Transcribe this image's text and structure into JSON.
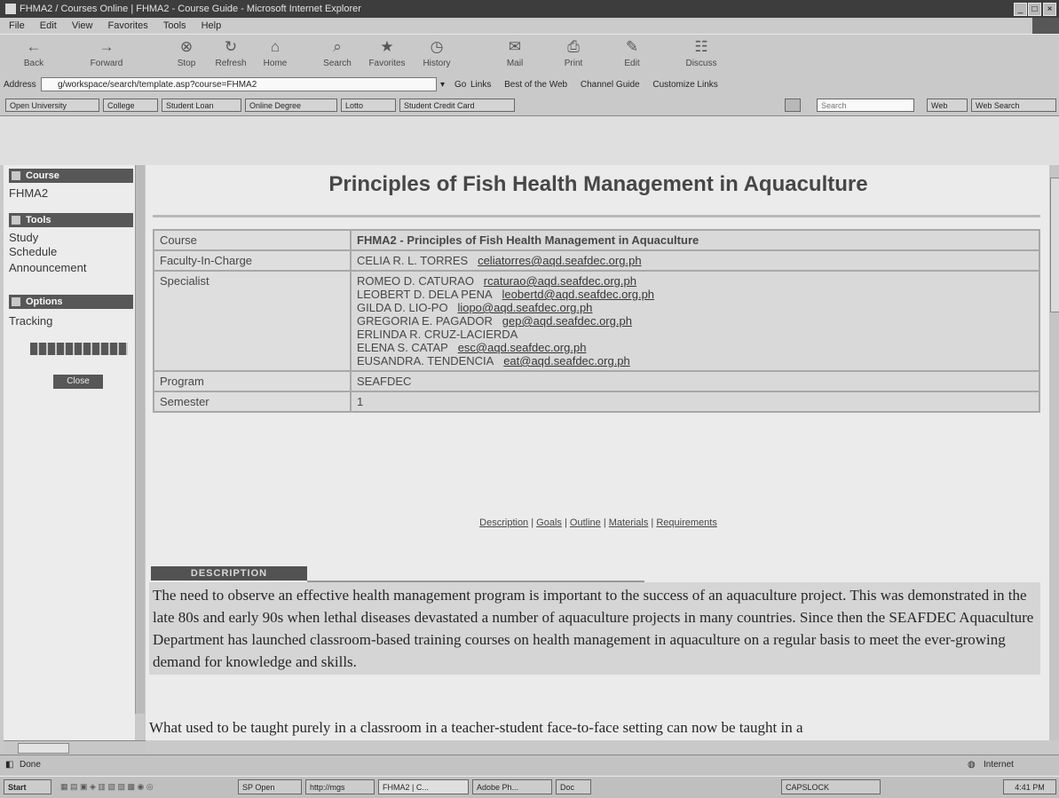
{
  "window": {
    "title": "FHMA2 / Courses Online | FHMA2 - Course Guide - Microsoft Internet Explorer"
  },
  "menu": [
    "File",
    "Edit",
    "View",
    "Favorites",
    "Tools",
    "Help"
  ],
  "toolbar": {
    "back": "Back",
    "forward": "Forward",
    "stop": "Stop",
    "refresh": "Refresh",
    "home": "Home",
    "search": "Search",
    "favorites": "Favorites",
    "history": "History",
    "mail": "Mail",
    "print": "Print",
    "edit": "Edit",
    "discuss": "Discuss"
  },
  "address": {
    "label": "Address",
    "url": "g/workspace/search/template.asp?course=FHMA2",
    "go": "Go",
    "links_label": "Links",
    "links": [
      "Best of the Web",
      "Channel Guide",
      "Customize Links"
    ]
  },
  "links_toolbar": {
    "items": [
      "Open University",
      "College",
      "Student Loan",
      "Online Degree",
      "Lotto",
      "Student Credit Card"
    ],
    "search_placeholder": "Search",
    "search_buttons": [
      "Web",
      "Web Search"
    ]
  },
  "sidebar": {
    "course_header": "Course",
    "course_code": "FHMA2",
    "tools_header": "Tools",
    "tools_items": [
      "Study",
      "Schedule",
      "Announcement"
    ],
    "options_header": "Options",
    "options_items": [
      "Tracking"
    ],
    "close_label": "Close"
  },
  "main": {
    "heading": "Principles of Fish Health Management in Aquaculture",
    "rows": [
      {
        "key": "Course",
        "value": "FHMA2 - Principles of Fish Health Management in Aquaculture"
      },
      {
        "key": "Faculty-In-Charge",
        "name": "CELIA R. L. TORRES",
        "email": "celiatorres@aqd.seafdec.org.ph"
      }
    ],
    "specialist_key": "Specialist",
    "specialists": [
      {
        "name": "ROMEO D. CATURAO",
        "email": "rcaturao@aqd.seafdec.org.ph"
      },
      {
        "name": "LEOBERT D. DELA PENA",
        "email": "leobertd@aqd.seafdec.org.ph"
      },
      {
        "name": "GILDA D. LIO-PO",
        "email": "liopo@aqd.seafdec.org.ph"
      },
      {
        "name": "GREGORIA E. PAGADOR",
        "email": "gep@aqd.seafdec.org.ph"
      },
      {
        "name": "ERLINDA R. CRUZ-LACIERDA",
        "email": ""
      },
      {
        "name": "ELENA S. CATAP",
        "email": "esc@aqd.seafdec.org.ph"
      },
      {
        "name": "EUSANDRA. TENDENCIA",
        "email": "eat@aqd.seafdec.org.ph"
      }
    ],
    "program_key": "Program",
    "program_value": "SEAFDEC",
    "semester_key": "Semester",
    "semester_value": "1",
    "section_links": [
      "Description",
      "Goals",
      "Outline",
      "Materials",
      "Requirements"
    ],
    "description_tab": "DESCRIPTION",
    "description": "The need to observe an effective health management program is important to the success of an aquaculture project. This was demonstrated in the late 80s and early 90s when lethal diseases devastated a number of aquaculture projects in many countries. Since then the SEAFDEC Aquaculture Department has launched classroom-based training courses on health management in aquaculture on a regular basis to meet the ever-growing demand for knowledge and skills.",
    "description2": "What used to be taught purely in a classroom in a teacher-student face-to-face setting can now be taught in a"
  },
  "status": {
    "text": "Done",
    "zone": "Internet"
  },
  "taskbar": {
    "start": "Start",
    "tasks": [
      "SP Open",
      "http://mgs",
      "FHMA2 | C...",
      "Adobe Ph...",
      "Doc",
      "CAPSLOCK"
    ],
    "clock": "4:41 PM"
  }
}
